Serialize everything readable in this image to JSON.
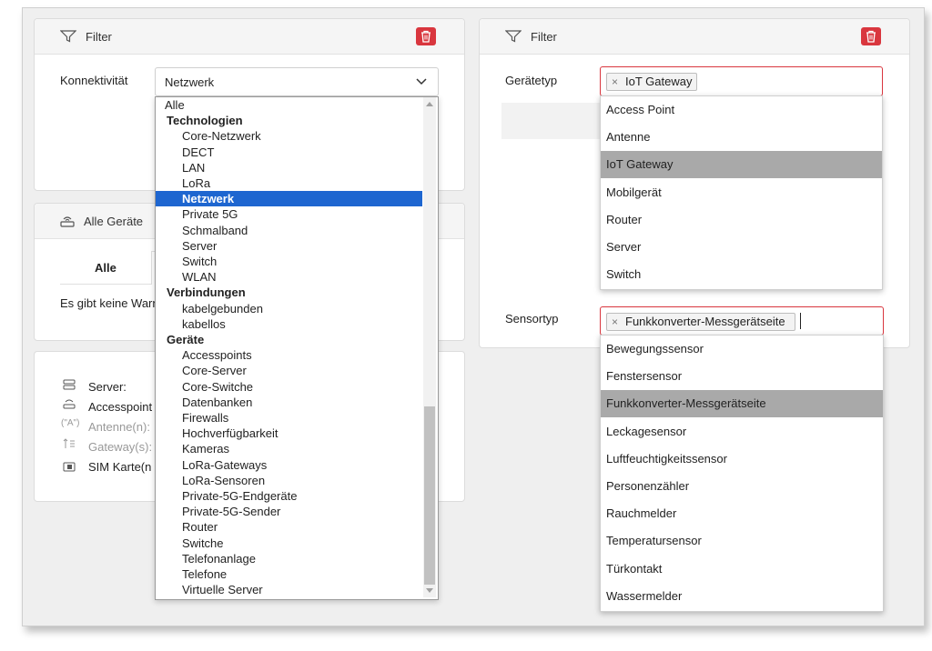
{
  "filter_left": {
    "title": "Filter",
    "konnektivitaet_label": "Konnektivität",
    "selected_value": "Netzwerk",
    "options": [
      {
        "label": "Alle",
        "type": "opt"
      },
      {
        "label": "Technologien",
        "type": "group"
      },
      {
        "label": "Core-Netzwerk",
        "type": "sub"
      },
      {
        "label": "DECT",
        "type": "sub"
      },
      {
        "label": "LAN",
        "type": "sub"
      },
      {
        "label": "LoRa",
        "type": "sub"
      },
      {
        "label": "Netzwerk",
        "type": "selected"
      },
      {
        "label": "Private 5G",
        "type": "sub"
      },
      {
        "label": "Schmalband",
        "type": "sub"
      },
      {
        "label": "Server",
        "type": "sub"
      },
      {
        "label": "Switch",
        "type": "sub"
      },
      {
        "label": "WLAN",
        "type": "sub"
      },
      {
        "label": "Verbindungen",
        "type": "group"
      },
      {
        "label": "kabelgebunden",
        "type": "sub"
      },
      {
        "label": "kabellos",
        "type": "sub"
      },
      {
        "label": "Geräte",
        "type": "group"
      },
      {
        "label": "Accesspoints",
        "type": "sub"
      },
      {
        "label": "Core-Server",
        "type": "sub"
      },
      {
        "label": "Core-Switche",
        "type": "sub"
      },
      {
        "label": "Datenbanken",
        "type": "sub"
      },
      {
        "label": "Firewalls",
        "type": "sub"
      },
      {
        "label": "Hochverfügbarkeit",
        "type": "sub"
      },
      {
        "label": "Kameras",
        "type": "sub"
      },
      {
        "label": "LoRa-Gateways",
        "type": "sub"
      },
      {
        "label": "LoRa-Sensoren",
        "type": "sub"
      },
      {
        "label": "Private-5G-Endgeräte",
        "type": "sub"
      },
      {
        "label": "Private-5G-Sender",
        "type": "sub"
      },
      {
        "label": "Router",
        "type": "sub"
      },
      {
        "label": "Switche",
        "type": "sub"
      },
      {
        "label": "Telefonanlage",
        "type": "sub"
      },
      {
        "label": "Telefone",
        "type": "sub"
      },
      {
        "label": "Virtuelle Server",
        "type": "sub"
      }
    ]
  },
  "alle_geraete": {
    "title": "Alle Geräte",
    "tab_alle": "Alle",
    "message": "Es gibt keine Warn"
  },
  "stats": {
    "server": "Server:",
    "accesspoint": "Accesspoint",
    "antenne": "Antenne(n):",
    "gateway": "Gateway(s):",
    "sim": "SIM Karte(n"
  },
  "filter_right": {
    "title": "Filter",
    "geraetetyp_label": "Gerätetyp",
    "geraetetyp_tag": "IoT Gateway",
    "geraetetyp_options": [
      "Access Point",
      "Antenne",
      "IoT Gateway",
      "Mobilgerät",
      "Router",
      "Server",
      "Switch"
    ],
    "geraetetyp_highlight": 2,
    "sensortyp_label": "Sensortyp",
    "sensortyp_tag": "Funkkonverter-Messgerätseite",
    "sensortyp_options": [
      "Bewegungssensor",
      "Fenstersensor",
      "Funkkonverter-Messgerätseite",
      "Leckagesensor",
      "Luftfeuchtigkeitssensor",
      "Personenzähler",
      "Rauchmelder",
      "Temperatursensor",
      "Türkontakt",
      "Wassermelder"
    ],
    "sensortyp_highlight": 2,
    "tag_remove": "×"
  },
  "colors": {
    "accent_selected": "#1e66d0",
    "danger": "#d9363e",
    "highlight": "#a9a9a9"
  }
}
